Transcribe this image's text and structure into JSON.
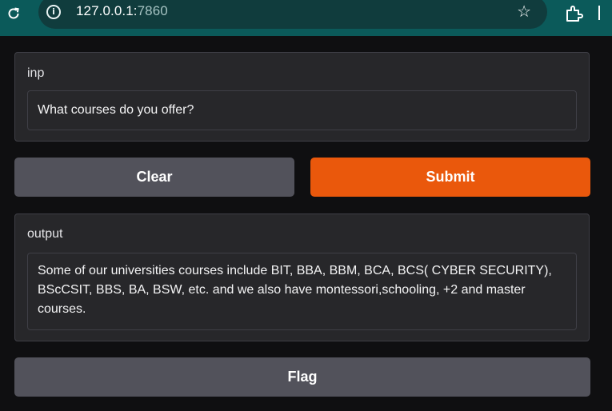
{
  "browser": {
    "url_host": "127.0.0.1:",
    "url_port": "7860",
    "icons": [
      "reload-icon",
      "site-info-icon",
      "bookmark-star-icon",
      "extensions-icon"
    ]
  },
  "input_panel": {
    "label": "inp",
    "value": "What courses do you offer?"
  },
  "buttons": {
    "clear_label": "Clear",
    "submit_label": "Submit",
    "flag_label": "Flag"
  },
  "output_panel": {
    "label": "output",
    "value": "Some of our universities courses include BIT, BBA, BBM, BCA, BCS( CYBER SECURITY), BScCSIT, BBS, BA, BSW, etc. and we also have montessori,schooling, +2 and master courses."
  },
  "colors": {
    "browser_bar": "#0b5a5a",
    "page_background": "#0f0f11",
    "panel_background": "#27272a",
    "primary_button": "#ea580c",
    "secondary_button": "#52525b"
  }
}
